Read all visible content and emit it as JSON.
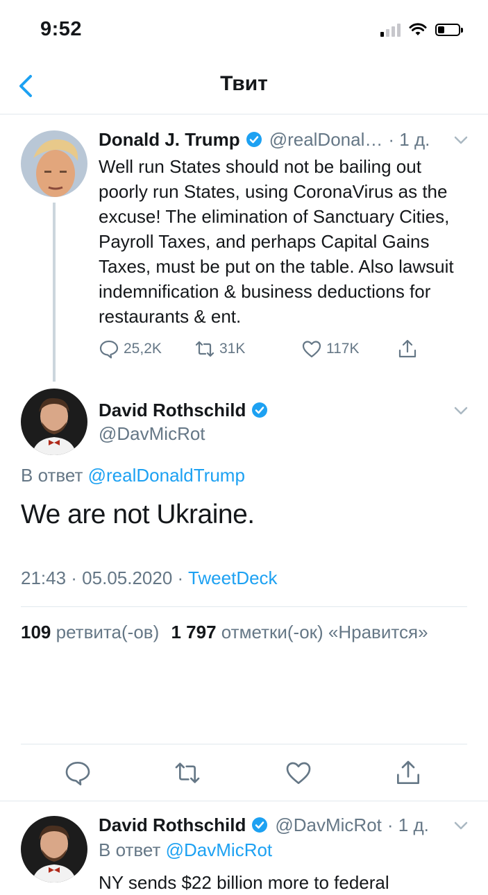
{
  "status_bar": {
    "time": "9:52"
  },
  "nav": {
    "title": "Твит"
  },
  "parent_tweet": {
    "name": "Donald J. Trump",
    "handle": "@realDonal…",
    "time": "· 1 д.",
    "text": "Well run States should not be bailing out poorly run States, using CoronaVirus as the excuse! The elimination of Sanctuary Cities, Payroll Taxes, and perhaps Capital Gains Taxes, must be put on the table. Also lawsuit indemnification & business deductions for restaurants & ent.",
    "replies": "25,2K",
    "retweets": "31K",
    "likes": "117K"
  },
  "main_tweet": {
    "name": "David Rothschild",
    "handle": "@DavMicRot",
    "reply_prefix": "В ответ",
    "reply_to": "@realDonaldTrump",
    "text": "We are not Ukraine.",
    "timestamp": "21:43 · 05.05.2020 ·",
    "source": "TweetDeck",
    "retweet_count": "109",
    "retweet_label": "ретвита(-ов)",
    "like_count": "1 797",
    "like_label": "отметки(-ок) «Нравится»"
  },
  "next_tweet": {
    "name": "David Rothschild",
    "handle": "@DavMicRot",
    "time": "· 1 д.",
    "reply_prefix": "В ответ",
    "reply_to": "@DavMicRot",
    "text_partial": "NY sends $22 billion more to federal"
  },
  "colors": {
    "accent": "#1da1f2",
    "muted": "#657786",
    "divider": "#e1e8ed"
  }
}
